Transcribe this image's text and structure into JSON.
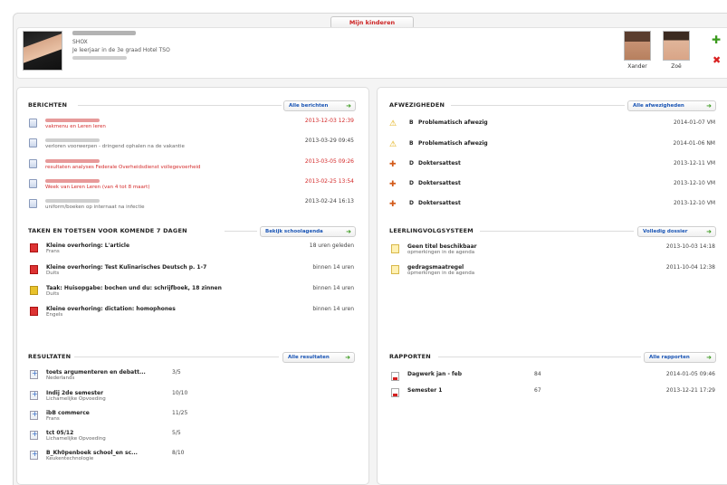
{
  "top_tab": "Mijn kinderen",
  "user": {
    "code": "SHOX",
    "class_line": "Je leerjaar in de 3e graad Hotel TSO"
  },
  "children": [
    {
      "name": "Xander"
    },
    {
      "name": "Zoë"
    }
  ],
  "berichten": {
    "title": "BERICHTEN",
    "button": "Alle berichten",
    "items": [
      {
        "subject": "vakmenu en Leren leren",
        "date": "2013-12-03 12:39",
        "unread": true
      },
      {
        "subject": "verloren voorwerpen - dringend ophalen na de vakantie",
        "date": "2013-03-29 09:45",
        "unread": false
      },
      {
        "subject": "resultaten analyses Federale Overheidsdienst vollegevoerheid",
        "date": "2013-03-05 09:26",
        "unread": true
      },
      {
        "subject": "Week van Leren Leren (van 4 tot 8 maart)",
        "date": "2013-02-25 13:54",
        "unread": true
      },
      {
        "subject": "uniform/boeken op internaat na infectie",
        "date": "2013-02-24 16:13",
        "unread": false
      }
    ]
  },
  "taken": {
    "title": "TAKEN EN TOETSEN VOOR KOMENDE 7 DAGEN",
    "button": "Bekijk schoolagenda",
    "items": [
      {
        "title": "Kleine overhoring: L'article",
        "subject": "Frans",
        "when": "18 uren geleden",
        "color": "red"
      },
      {
        "title": "Kleine overhoring: Test Kulinarisches Deutsch p. 1-7",
        "subject": "Duits",
        "when": "binnen 14 uren",
        "color": "red"
      },
      {
        "title": "Taak: Huisopgabe: bochen und du: schrijfboek, 18 zinnen",
        "subject": "Duits",
        "when": "binnen 14 uren",
        "color": "yellow"
      },
      {
        "title": "Kleine overhoring: dictation: homophones",
        "subject": "Engels",
        "when": "binnen 14 uren",
        "color": "red"
      }
    ]
  },
  "resultaten": {
    "title": "RESULTATEN",
    "button": "Alle resultaten",
    "items": [
      {
        "title": "toets argumenteren en debatt...",
        "subject": "Nederlands",
        "score": "3/5"
      },
      {
        "title": "Indij 2de semester",
        "subject": "Lichamelijke Opvoeding",
        "score": "10/10"
      },
      {
        "title": "ibB commerce",
        "subject": "Frans",
        "score": "11/25"
      },
      {
        "title": "tct 05/12",
        "subject": "Lichamelijke Opvoeding",
        "score": "5/5"
      },
      {
        "title": "B_Kh0penboek school_en sc...",
        "subject": "Keukentechnologie",
        "score": "8/10"
      }
    ]
  },
  "afwezigheden": {
    "title": "AFWEZIGHEDEN",
    "button": "Alle afwezigheden",
    "items": [
      {
        "code": "B",
        "label": "Problematisch afwezig",
        "date": "2014-01-07 VM",
        "type": "warn"
      },
      {
        "code": "B",
        "label": "Problematisch afwezig",
        "date": "2014-01-06 NM",
        "type": "warn"
      },
      {
        "code": "D",
        "label": "Doktersattest",
        "date": "2013-12-11 VM",
        "type": "att"
      },
      {
        "code": "D",
        "label": "Doktersattest",
        "date": "2013-12-10 VM",
        "type": "att"
      },
      {
        "code": "D",
        "label": "Doktersattest",
        "date": "2013-12-10 VM",
        "type": "att"
      }
    ]
  },
  "lvs": {
    "title": "LEERLINGVOLGSYSTEEM",
    "button": "Volledig dossier",
    "items": [
      {
        "title": "Geen titel beschikbaar",
        "sub": "opmerkingen in de agenda",
        "date": "2013-10-03 14:18"
      },
      {
        "title": "gedragsmaatregel",
        "sub": "opmerkingen in de agenda",
        "date": "2011-10-04 12:38"
      }
    ]
  },
  "rapporten": {
    "title": "RAPPORTEN",
    "button": "Alle rapporten",
    "items": [
      {
        "title": "Dagwerk jan - feb",
        "score": "84",
        "date": "2014-01-05 09:46"
      },
      {
        "title": "Semester 1",
        "score": "67",
        "date": "2013-12-21 17:29"
      }
    ]
  }
}
